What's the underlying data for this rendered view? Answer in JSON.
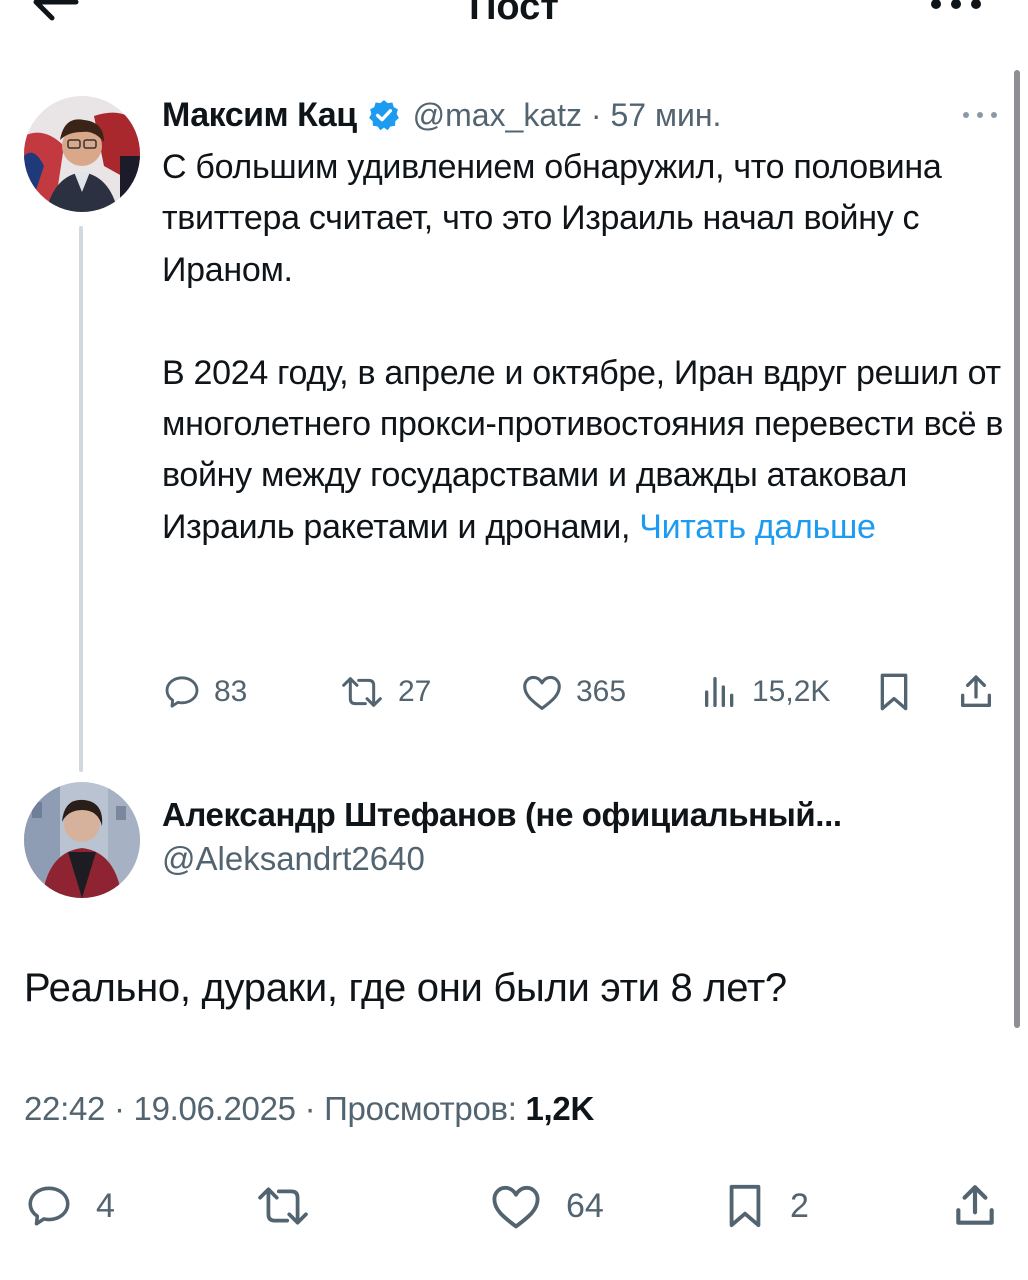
{
  "header": {
    "title": "Пост",
    "back_icon": "arrow-left-icon",
    "more_icon": "more-horizontal-icon"
  },
  "quoted_tweet": {
    "author_name": "Максим Кац",
    "verified": true,
    "handle": "@max_katz",
    "time": "57 мин.",
    "text": "С большим удивлением обнаружил, что половина твиттера считает, что это Израиль начал войну с Ираном.\n\nВ 2024 году, в апреле и октябре, Иран вдруг решил от многолетнего прокси-противостояния перевести всё в войну между государствами и дважды атаковал Израиль ракетами и дронами, ",
    "read_more": "Читать дальше",
    "stats": {
      "replies": "83",
      "retweets": "27",
      "likes": "365",
      "views": "15,2K"
    }
  },
  "reply": {
    "author_name": "Александр Штефанов (не официальный...",
    "handle": "@Aleksandrt2640",
    "text": "Реально, дураки, где они были эти 8 лет?",
    "time": "22:42",
    "date": "19.06.2025",
    "views_label": "Просмотров:",
    "views": "1,2K",
    "stats": {
      "replies": "4",
      "likes": "64",
      "bookmarks": "2"
    }
  },
  "colors": {
    "accent": "#1d9bf0",
    "text": "#0f1419",
    "secondary": "#536471",
    "thread_line": "#cfd9de"
  }
}
